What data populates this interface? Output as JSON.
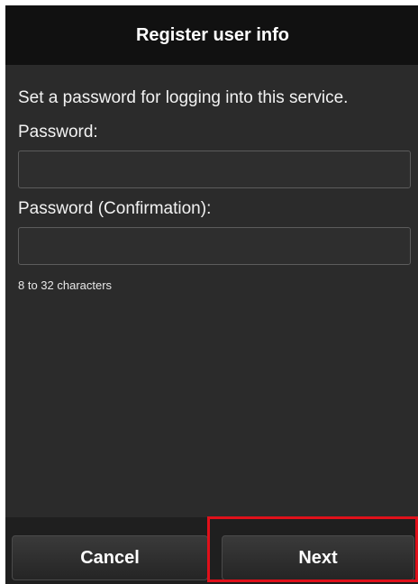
{
  "header": {
    "title": "Register user info"
  },
  "form": {
    "instruction": "Set a password for logging into this service.",
    "password_label": "Password:",
    "password_value": "",
    "confirm_label": "Password (Confirmation):",
    "confirm_value": "",
    "hint": "8 to 32 characters"
  },
  "footer": {
    "cancel_label": "Cancel",
    "next_label": "Next"
  },
  "colors": {
    "background": "#2b2b2b",
    "header": "#111111",
    "highlight": "#e0101a"
  }
}
